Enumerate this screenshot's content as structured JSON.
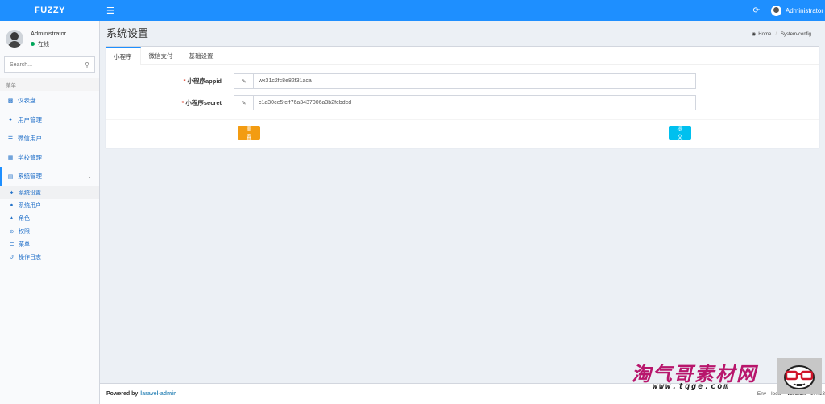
{
  "app": {
    "logo": "FUZZY"
  },
  "topbar": {
    "username": "Administrator"
  },
  "sidebar": {
    "user": {
      "name": "Administrator",
      "status": "在线"
    },
    "search_placeholder": "Search...",
    "header": "菜单",
    "items": [
      {
        "label": "仪表盘",
        "icon": "bar-chart-icon"
      },
      {
        "label": "用户管理",
        "icon": "users-icon"
      },
      {
        "label": "微信用户",
        "icon": "list-icon"
      },
      {
        "label": "学校管理",
        "icon": "school-icon"
      },
      {
        "label": "系统管理",
        "icon": "system-icon"
      }
    ],
    "subitems": [
      {
        "label": "系统设置",
        "icon": "wrench-icon"
      },
      {
        "label": "系统用户",
        "icon": "users-icon"
      },
      {
        "label": "角色",
        "icon": "user-icon"
      },
      {
        "label": "权限",
        "icon": "ban-icon"
      },
      {
        "label": "菜单",
        "icon": "bars-icon"
      },
      {
        "label": "操作日志",
        "icon": "history-icon"
      }
    ]
  },
  "page": {
    "title": "系统设置",
    "breadcrumb": {
      "home": "Home",
      "current": "System-config"
    }
  },
  "tabs": [
    "小程序",
    "微信支付",
    "基础设置"
  ],
  "form": {
    "fields": [
      {
        "label": "小程序appid",
        "value": "wx31c2fc8e82f31aca"
      },
      {
        "label": "小程序secret",
        "value": "c1a30ce5fcff76a3437006a3b2febdcd"
      }
    ],
    "reset_label": "重置",
    "submit_label": "提交"
  },
  "footer": {
    "powered": "Powered by",
    "link": "laravel-admin",
    "env_label": "Env",
    "env_value": "local",
    "version_label": "Version",
    "version_value": "1.4.13"
  },
  "watermark": {
    "title": "淘气哥素材网",
    "url": "www.tqge.com"
  },
  "colors": {
    "primary": "#1e8fff",
    "reset": "#f39c12",
    "submit": "#00c0ef",
    "online": "#00a65a"
  }
}
